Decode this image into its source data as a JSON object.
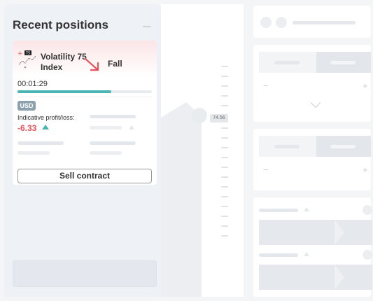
{
  "sidebar": {
    "title": "Recent positions"
  },
  "position": {
    "market_badge": "75",
    "market_name": "Volatility 75 Index",
    "contract_type": "Fall",
    "timer": "00:01:29",
    "progress": 0.7,
    "currency": "USD",
    "pl_label": "Indicative profit/loss:",
    "pl_value": "-6.33",
    "sell_label": "Sell contract"
  },
  "chart": {
    "price_tag": "74.56"
  },
  "controls": {
    "minus": "−",
    "plus": "+"
  },
  "colors": {
    "loss": "#e6535b",
    "accent": "#4bb4b3",
    "fall_arrow": "#e6535b"
  },
  "icons": {
    "market": "volatility-chart-icon",
    "fall": "fall-arrow-icon",
    "profit_direction": "triangle-up-icon"
  }
}
